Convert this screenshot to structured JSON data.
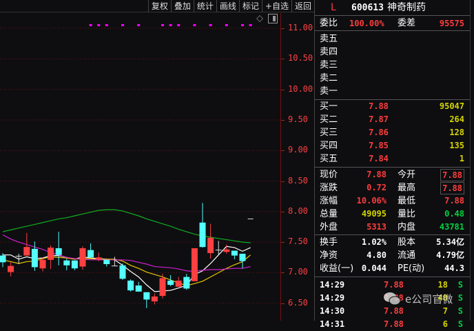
{
  "toolbar": {
    "items": [
      "复权",
      "叠加",
      "统计",
      "画线",
      "标记",
      "+自选",
      "返回"
    ]
  },
  "price_axis": {
    "labels": [
      "11.00",
      "10.50",
      "10.00",
      "9.50",
      "9.00",
      "8.50",
      "8.00",
      "7.50",
      "7.00",
      "6.50"
    ]
  },
  "chart_data": {
    "type": "candlestick",
    "ylim": [
      6.3,
      11.05
    ],
    "candles": [
      [
        7.28,
        7.32,
        7.09,
        7.17
      ],
      [
        7.01,
        7.17,
        6.94,
        7.11
      ],
      [
        7.27,
        7.31,
        7.14,
        7.27
      ],
      [
        7.28,
        7.65,
        7.28,
        7.42
      ],
      [
        7.39,
        7.51,
        7.03,
        7.09
      ],
      [
        7.07,
        7.25,
        7.02,
        7.21
      ],
      [
        7.21,
        7.45,
        7.06,
        7.41
      ],
      [
        7.4,
        7.67,
        7.12,
        7.29
      ],
      [
        7.2,
        7.23,
        7.04,
        7.12
      ],
      [
        7.2,
        7.2,
        7.04,
        7.07
      ],
      [
        7.1,
        7.43,
        7.05,
        7.4
      ],
      [
        7.37,
        7.48,
        7.25,
        7.25
      ],
      [
        7.22,
        7.33,
        7.19,
        7.25
      ],
      [
        7.21,
        7.21,
        7.1,
        7.14
      ],
      [
        7.11,
        7.26,
        7.11,
        7.11
      ],
      [
        7.12,
        7.15,
        6.88,
        6.9
      ],
      [
        6.87,
        6.89,
        6.69,
        6.71
      ],
      [
        6.79,
        6.85,
        6.69,
        6.69
      ],
      [
        6.68,
        6.68,
        6.42,
        6.56
      ],
      [
        6.53,
        6.66,
        6.48,
        6.61
      ],
      [
        6.62,
        6.98,
        6.58,
        6.91
      ],
      [
        6.87,
        6.96,
        6.78,
        6.8
      ],
      [
        6.77,
        6.93,
        6.77,
        6.87
      ],
      [
        6.93,
        6.98,
        6.72,
        6.74
      ],
      [
        6.86,
        7.4,
        6.86,
        7.4
      ],
      [
        7.82,
        8.14,
        7.41,
        7.42
      ],
      [
        7.32,
        7.8,
        7.23,
        7.57
      ],
      [
        7.37,
        7.52,
        7.29,
        7.37
      ],
      [
        7.34,
        7.46,
        7.31,
        7.38
      ],
      [
        7.36,
        7.36,
        7.22,
        7.28
      ],
      [
        7.31,
        7.31,
        7.07,
        7.19
      ],
      [
        7.88,
        7.88,
        7.88,
        7.88
      ]
    ],
    "ma": [
      {
        "name": "MA5",
        "color": "#ffffff",
        "values": [
          7.29,
          7.29,
          7.22,
          7.26,
          7.23,
          7.24,
          7.28,
          7.28,
          7.25,
          7.22,
          7.26,
          7.24,
          7.23,
          7.22,
          7.21,
          7.12,
          7.02,
          6.93,
          6.8,
          6.69,
          6.7,
          6.71,
          6.75,
          6.79,
          6.97,
          7.03,
          7.15,
          7.29,
          7.43,
          7.41,
          7.35,
          7.41
        ]
      },
      {
        "name": "MA10",
        "color": "#e8c800",
        "values": [
          7.21,
          7.18,
          7.15,
          7.18,
          7.19,
          7.23,
          7.26,
          7.25,
          7.24,
          7.22,
          7.23,
          7.23,
          7.22,
          7.22,
          7.22,
          7.19,
          7.12,
          7.07,
          7.01,
          6.97,
          6.93,
          6.88,
          6.83,
          6.79,
          6.82,
          6.86,
          6.93,
          7.0,
          7.07,
          7.13,
          7.18,
          7.29
        ]
      },
      {
        "name": "MA20",
        "color": "#d020d0",
        "values": [
          7.62,
          7.55,
          7.5,
          7.46,
          7.42,
          7.38,
          7.33,
          7.29,
          7.25,
          7.23,
          7.22,
          7.21,
          7.21,
          7.21,
          7.21,
          7.21,
          7.2,
          7.17,
          7.14,
          7.1,
          7.09,
          7.08,
          7.06,
          7.03,
          7.02,
          7.04,
          7.05,
          7.05,
          7.06,
          7.07,
          7.07,
          7.1
        ]
      },
      {
        "name": "MA60",
        "color": "#10b020",
        "values": [
          7.67,
          7.7,
          7.73,
          7.76,
          7.79,
          7.82,
          7.85,
          7.88,
          7.9,
          7.93,
          7.96,
          7.99,
          8.02,
          8.03,
          8.03,
          8.01,
          7.97,
          7.93,
          7.88,
          7.84,
          7.8,
          7.76,
          7.71,
          7.67,
          7.63,
          7.6,
          7.58,
          7.56,
          7.54,
          7.52,
          7.5,
          7.49
        ]
      }
    ],
    "gridlines": [
      11.0,
      10.5,
      10.0,
      9.5,
      9.0,
      8.5,
      8.0,
      7.5,
      7.0,
      6.5
    ],
    "up_color": "#ff4040",
    "down_color": "#54ffff",
    "marker_candles": [
      11,
      12,
      13,
      15,
      17,
      20,
      21,
      22,
      24,
      26,
      28,
      30,
      31
    ]
  },
  "quote": {
    "flag": "L",
    "code": "600613",
    "name": "神奇制药",
    "weibi_label": "委比",
    "weibi": "100.00%",
    "weicha_label": "委差",
    "weicha": "95575",
    "sell": [
      {
        "label": "卖五"
      },
      {
        "label": "卖四"
      },
      {
        "label": "卖三"
      },
      {
        "label": "卖二"
      },
      {
        "label": "卖一"
      }
    ],
    "buy": [
      {
        "label": "买一",
        "price": "7.88",
        "vol": "95047"
      },
      {
        "label": "买二",
        "price": "7.87",
        "vol": "264"
      },
      {
        "label": "买三",
        "price": "7.86",
        "vol": "128"
      },
      {
        "label": "买四",
        "price": "7.85",
        "vol": "135"
      },
      {
        "label": "买五",
        "price": "7.84",
        "vol": "1"
      }
    ],
    "stats": [
      {
        "l1": "现价",
        "v1": "7.88",
        "c1": "red",
        "l2": "今开",
        "v2": "7.88",
        "c2": "red",
        "b2": true
      },
      {
        "l1": "涨跌",
        "v1": "0.72",
        "c1": "red",
        "l2": "最高",
        "v2": "7.88",
        "c2": "red",
        "b2": true
      },
      {
        "l1": "涨幅",
        "v1": "10.06%",
        "c1": "red",
        "l2": "最低",
        "v2": "7.88",
        "c2": "red"
      },
      {
        "l1": "总量",
        "v1": "49095",
        "c1": "yel",
        "l2": "量比",
        "v2": "0.48",
        "c2": "grn"
      },
      {
        "l1": "外盘",
        "v1": "5313",
        "c1": "red",
        "l2": "内盘",
        "v2": "43781",
        "c2": "grn"
      }
    ],
    "fund": [
      {
        "l1": "换手",
        "v1": "1.02%",
        "l2": "股本",
        "v2": "5.34亿"
      },
      {
        "l1": "净资",
        "v1": "4.80",
        "l2": "流通",
        "v2": "4.79亿"
      },
      {
        "l1": "收益(一)",
        "v1": "0.044",
        "l2": "PE(动)",
        "v2": "44.3"
      }
    ],
    "ticks": [
      {
        "time": "14:29",
        "price": "7.88",
        "vol": "18",
        "side": "S"
      },
      {
        "time": "14:29",
        "price": "7.88",
        "vol": "40",
        "side": "S"
      },
      {
        "time": "14:30",
        "price": "7.88",
        "vol": "7",
        "side": "S"
      },
      {
        "time": "14:31",
        "price": "7.88",
        "vol": "6",
        "side": "S"
      }
    ]
  },
  "watermark": "e公司官微"
}
